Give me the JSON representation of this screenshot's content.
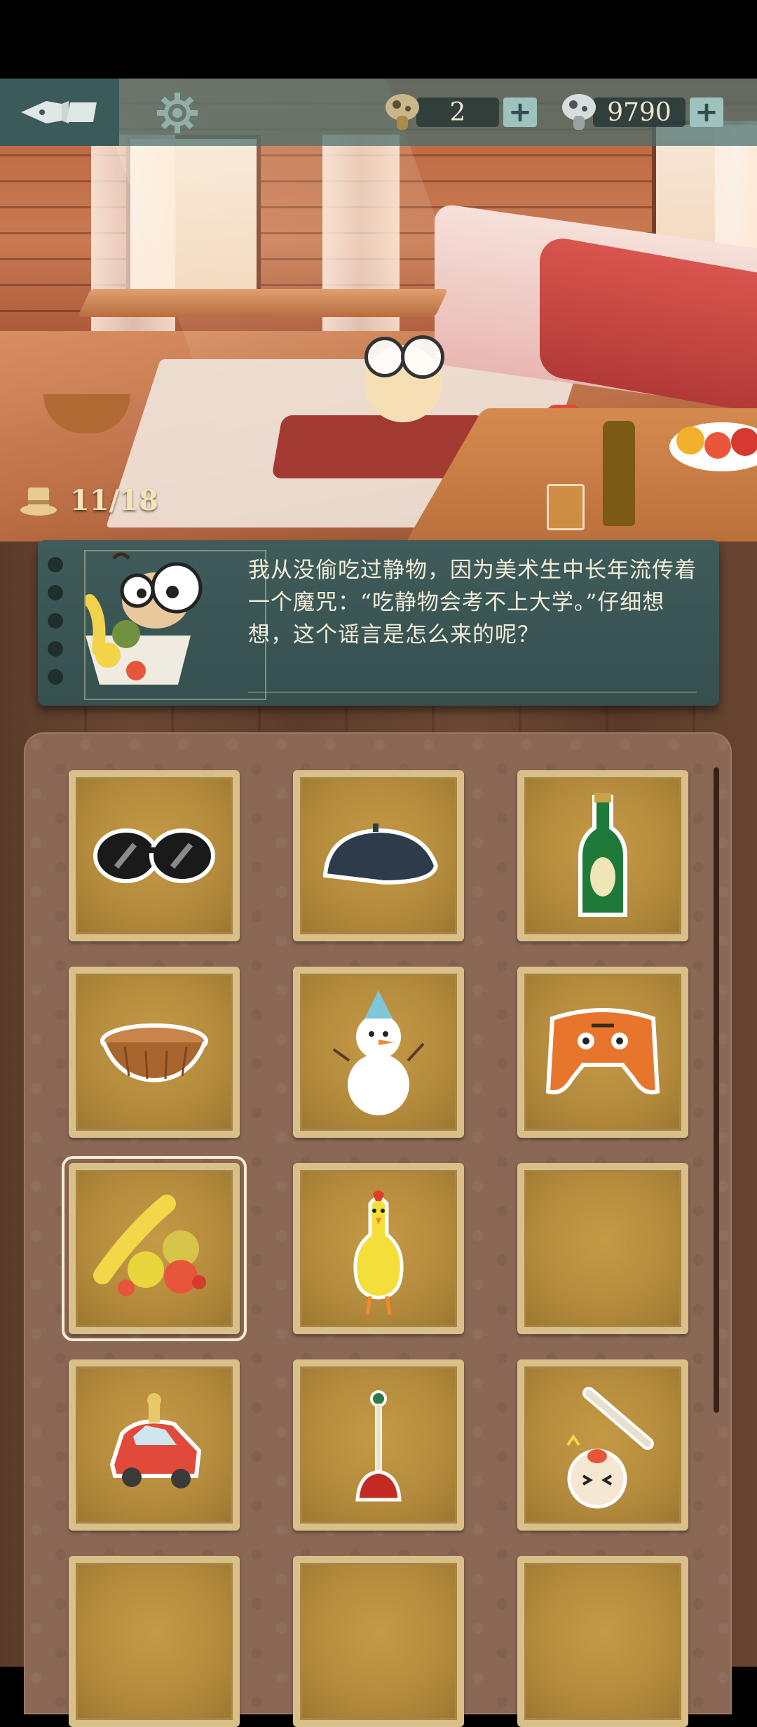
{
  "hud": {
    "pen_icon": "fountain-pen-icon",
    "settings_icon": "gear-icon",
    "hint_currency": {
      "icon": "hint-mushroom-icon",
      "value": "2",
      "plus": "+"
    },
    "coin_currency": {
      "icon": "coin-mushroom-icon",
      "value": "9790",
      "plus": "+"
    }
  },
  "scene": {
    "progress": {
      "icon": "top-hat-icon",
      "text": "11/18"
    }
  },
  "dialog": {
    "portrait_icon": "character-with-fruit-bowl-icon",
    "text": "我从没偷吃过静物，因为美术生中长年流传着一个魔咒：“吃静物会考不上大学。”仔细想想，这个谣言是怎么来的呢？"
  },
  "inventory": {
    "items": [
      {
        "icon": "sunglasses-icon",
        "empty": false
      },
      {
        "icon": "beret-icon",
        "empty": false
      },
      {
        "icon": "green-bottle-icon",
        "empty": false
      },
      {
        "icon": "wicker-basket-icon",
        "empty": false
      },
      {
        "icon": "snowman-icon",
        "empty": false
      },
      {
        "icon": "tiger-hat-icon",
        "empty": false
      },
      {
        "icon": "fruit-pile-icon",
        "empty": false,
        "selected": true
      },
      {
        "icon": "rubber-chicken-icon",
        "empty": false
      },
      {
        "icon": "empty-slot",
        "empty": true
      },
      {
        "icon": "toy-car-icon",
        "empty": false
      },
      {
        "icon": "plunger-icon",
        "empty": false
      },
      {
        "icon": "baton-and-face-icon",
        "empty": false
      },
      {
        "icon": "empty-slot",
        "empty": true
      },
      {
        "icon": "empty-slot",
        "empty": true
      },
      {
        "icon": "empty-slot",
        "empty": true
      }
    ]
  },
  "colors": {
    "hud_teal": "#3b5b5a",
    "dialog_bg": "#3f5c5a",
    "slot_gold": "#c59a46",
    "slot_border": "#d9c089",
    "wood_dark": "#5a3b2a"
  }
}
